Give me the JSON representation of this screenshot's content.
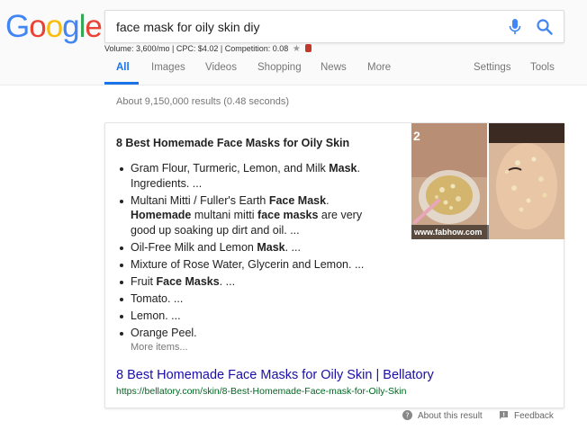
{
  "brand": {
    "logo_letters": [
      "G",
      "o",
      "o",
      "g",
      "l",
      "e"
    ],
    "logo_colors": [
      "#4285F4",
      "#EA4335",
      "#FBBC05",
      "#4285F4",
      "#34A853",
      "#EA4335"
    ]
  },
  "search": {
    "query": "face mask for oily skin diy",
    "mic_icon": "microphone-icon",
    "search_icon": "search-icon"
  },
  "keyword_stats": {
    "text": "Volume: 3,600/mo | CPC: $4.02 | Competition: 0.08",
    "star": "★"
  },
  "nav": {
    "tabs": [
      {
        "label": "All",
        "active": true
      },
      {
        "label": "Images"
      },
      {
        "label": "Videos"
      },
      {
        "label": "Shopping"
      },
      {
        "label": "News"
      },
      {
        "label": "More"
      }
    ],
    "settings": "Settings",
    "tools": "Tools"
  },
  "results_info": "About 9,150,000 results (0.48 seconds)",
  "featured_snippet": {
    "title": "8 Best Homemade Face Masks for Oily Skin",
    "items": [
      [
        {
          "t": "Gram Flour, Turmeric, Lemon, and Milk "
        },
        {
          "t": "Mask",
          "b": true
        },
        {
          "t": ". Ingredients. ..."
        }
      ],
      [
        {
          "t": "Multani Mitti / Fuller's Earth "
        },
        {
          "t": "Face Mask",
          "b": true
        },
        {
          "t": ". "
        },
        {
          "t": "Homemade",
          "b": true
        },
        {
          "t": " multani mitti "
        },
        {
          "t": "face masks",
          "b": true
        },
        {
          "t": " are very good up soaking up dirt and oil. ..."
        }
      ],
      [
        {
          "t": "Oil-Free Milk and Lemon "
        },
        {
          "t": "Mask",
          "b": true
        },
        {
          "t": ". ..."
        }
      ],
      [
        {
          "t": "Mixture of Rose Water, Glycerin and Lemon. ..."
        }
      ],
      [
        {
          "t": "Fruit "
        },
        {
          "t": "Face Masks",
          "b": true
        },
        {
          "t": ". ..."
        }
      ],
      [
        {
          "t": "Tomato. ..."
        }
      ],
      [
        {
          "t": "Lemon. ..."
        }
      ],
      [
        {
          "t": "Orange Peel."
        }
      ]
    ],
    "more_items": "More items...",
    "image": {
      "number": "2",
      "source": "www.fabhow.com"
    },
    "link_title": "8 Best Homemade Face Masks for Oily Skin | Bellatory",
    "link_url": "https://bellatory.com/skin/8-Best-Homemade-Face-mask-for-Oily-Skin"
  },
  "footer": {
    "about": "About this result",
    "feedback": "Feedback"
  }
}
